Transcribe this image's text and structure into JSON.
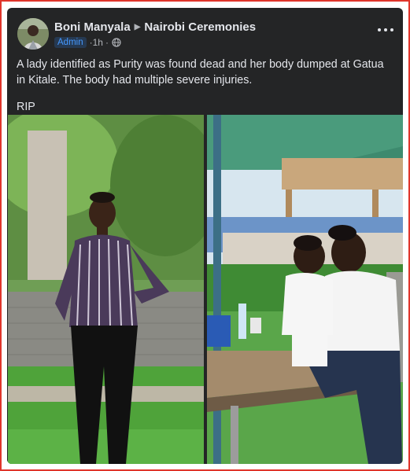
{
  "post": {
    "author": "Boni Manyala",
    "group": "Nairobi Ceremonies",
    "role_badge": "Admin",
    "time": "1h",
    "separator": "·",
    "body": "A lady identified as Purity was found dead and her body dumped at Gatua in Kitale. The body had multiple severe injuries.",
    "footer_text": "RIP",
    "icons": {
      "arrow": "triangle-right-icon",
      "privacy": "globe-icon",
      "menu": "more-options-icon"
    }
  },
  "colors": {
    "card_bg": "#242526",
    "text_primary": "#e4e6eb",
    "text_secondary": "#b0b3b8",
    "badge_bg": "#263951",
    "badge_text": "#4599ff",
    "frame_border": "#e0352b"
  }
}
